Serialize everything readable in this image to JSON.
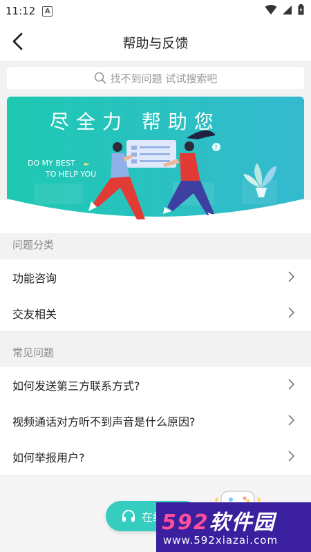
{
  "status_bar": {
    "time": "11:12",
    "notification_icon": "A"
  },
  "header": {
    "title": "帮助与反馈"
  },
  "search": {
    "placeholder": "找不到问题 试试搜索吧"
  },
  "banner": {
    "title": "尽全力  帮助您",
    "line1": "DO MY BEST",
    "line2": "TO HELP YOU"
  },
  "categories": {
    "header": "问题分类",
    "items": [
      {
        "label": "功能咨询"
      },
      {
        "label": "交友相关"
      }
    ]
  },
  "faq": {
    "header": "常见问题",
    "items": [
      {
        "label": "如何发送第三方联系方式?"
      },
      {
        "label": "视频通话对方听不到声音是什么原因?"
      },
      {
        "label": "如何举报用户?"
      }
    ]
  },
  "service_button": {
    "label": "在线客服"
  },
  "watermark": {
    "num": "592",
    "name": "软件园",
    "url": "www.592xiazai.com"
  },
  "colors": {
    "accent": "#35cdc0",
    "banner_start": "#1ec9b2",
    "banner_end": "#35b9cf"
  }
}
